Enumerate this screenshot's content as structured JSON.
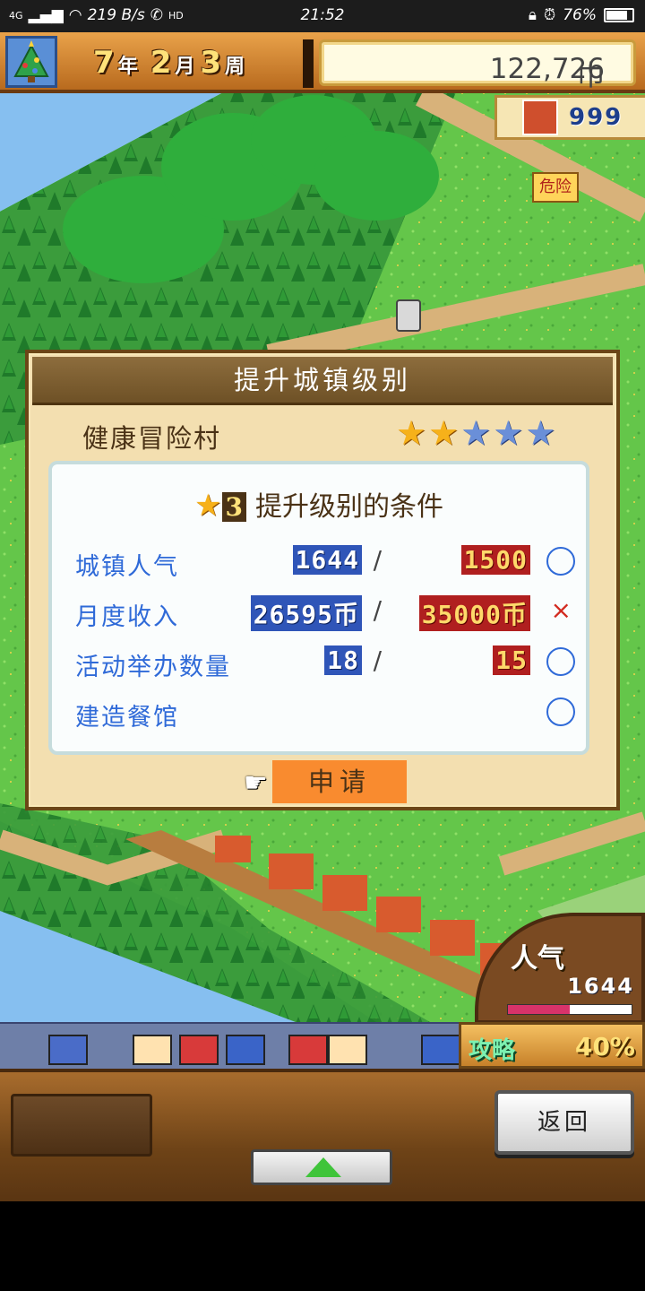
{
  "status_bar": {
    "network": "4G",
    "speed": "219 B/s",
    "hd": "HD",
    "time": "21:52",
    "battery": "76%",
    "battery_level": 0.76
  },
  "hud": {
    "year_num": "7",
    "year_unit": "年",
    "month_num": "2",
    "month_unit": "月",
    "week_num": "3",
    "week_unit": "周",
    "money": "122,726",
    "money_unit": "巾",
    "houses": "999",
    "danger_sign": "危险"
  },
  "dialog": {
    "title": "提升城镇级别",
    "town_name": "健康冒险村",
    "stars_filled": 2,
    "stars_total": 5,
    "cond_star_num": "3",
    "cond_title": "提升级别的条件",
    "conditions": [
      {
        "label": "城镇人气",
        "current": "1644",
        "required": "1500",
        "met": true
      },
      {
        "label": "月度收入",
        "current": "26595币",
        "required": "35000币",
        "met": false
      },
      {
        "label": "活动举办数量",
        "current": "18",
        "required": "15",
        "met": true
      },
      {
        "label": "建造餐馆",
        "current": "",
        "required": "",
        "met": true
      }
    ],
    "apply_label": "申请"
  },
  "gauge": {
    "title": "人气",
    "value": "1644",
    "bar_level": 0.5
  },
  "guide": {
    "label": "攻略",
    "value": "40%"
  },
  "bottom": {
    "back_label": "返回"
  }
}
